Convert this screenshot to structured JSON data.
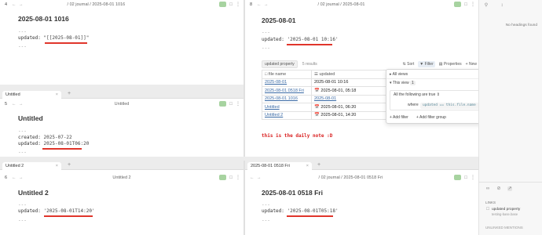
{
  "colors": {
    "accent_red": "#e0352b",
    "link": "#3a6aa5",
    "badge_green": "#a7d3a0"
  },
  "panes": {
    "p1": {
      "number": "4",
      "breadcrumb": "/ 02 journal / 2025-08-01 1016",
      "title": "2025-08-01 1016",
      "dash_top": "---",
      "prop_key": "updated:",
      "prop_val": "\"[[2025-08-01]]\"",
      "dash_bottom": "---"
    },
    "p2": {
      "number": "8",
      "breadcrumb": "/ 02 journal / 2025-08-01",
      "title": "2025-08-01",
      "dash_top": "---",
      "prop_key": "updated:",
      "prop_val": "'2025-08-01 10:16'",
      "dash_bottom": "---"
    },
    "p3": {
      "tab": "Untitled",
      "number": "5",
      "center_title": "Untitled",
      "title": "Untitled",
      "dash_top": "---",
      "created_key": "created:",
      "created_val": "2025-07-22",
      "prop_key": "updated:",
      "prop_val": "2025-08-01T06:20",
      "dash_bottom": "---"
    },
    "p4": {
      "tab": "Untitled 2",
      "number": "6",
      "center_title": "Untitled 2",
      "title": "Untitled 2",
      "dash_top": "---",
      "prop_key": "updated:",
      "prop_val": "'2025-08-01T14:20'",
      "dash_bottom": "---"
    },
    "p5": {
      "tab": "2025-08-01 0518 Fri",
      "breadcrumb": "/ 02 journal / 2025-08-01 0518 Fri",
      "title": "2025-08-01 0518 Fri",
      "dash_top": "---",
      "prop_key": "updated:",
      "prop_val": "'2025-08-01T05:18'",
      "dash_bottom": "---"
    }
  },
  "bases": {
    "view_name": "updated property",
    "results": "5 results",
    "sort": "Sort",
    "filter": "Filter",
    "properties": "Properties",
    "new": "New",
    "columns": [
      "file name",
      "updated"
    ],
    "rows": [
      {
        "name": "2025-08-01",
        "updated": "2025-08-01 10:16"
      },
      {
        "name": "2025-08-01 0518 Fri",
        "updated": "2025-08-01, 05:18"
      },
      {
        "name": "2025-08-01 1016",
        "updated": "2025-08-01"
      },
      {
        "name": "Untitled",
        "updated": "2025-08-01, 06:20"
      },
      {
        "name": "Untitled 2",
        "updated": "2025-08-01, 14:20"
      }
    ],
    "note": "this is the daily note :D"
  },
  "filter_popup": {
    "all_views": "All views",
    "this_view": "This view",
    "badge": "1",
    "mode": "All the following are true",
    "where": "where",
    "condition": "updated == this.file.name",
    "add_filter": "Add filter",
    "add_group": "Add filter group"
  },
  "sidebar": {
    "no_headings": "No headings found",
    "links_header": "LINKS",
    "backlink_name": "updated property",
    "backlink_path": "testing-base.base",
    "unlinked": "UNLINKED MENTIONS"
  }
}
